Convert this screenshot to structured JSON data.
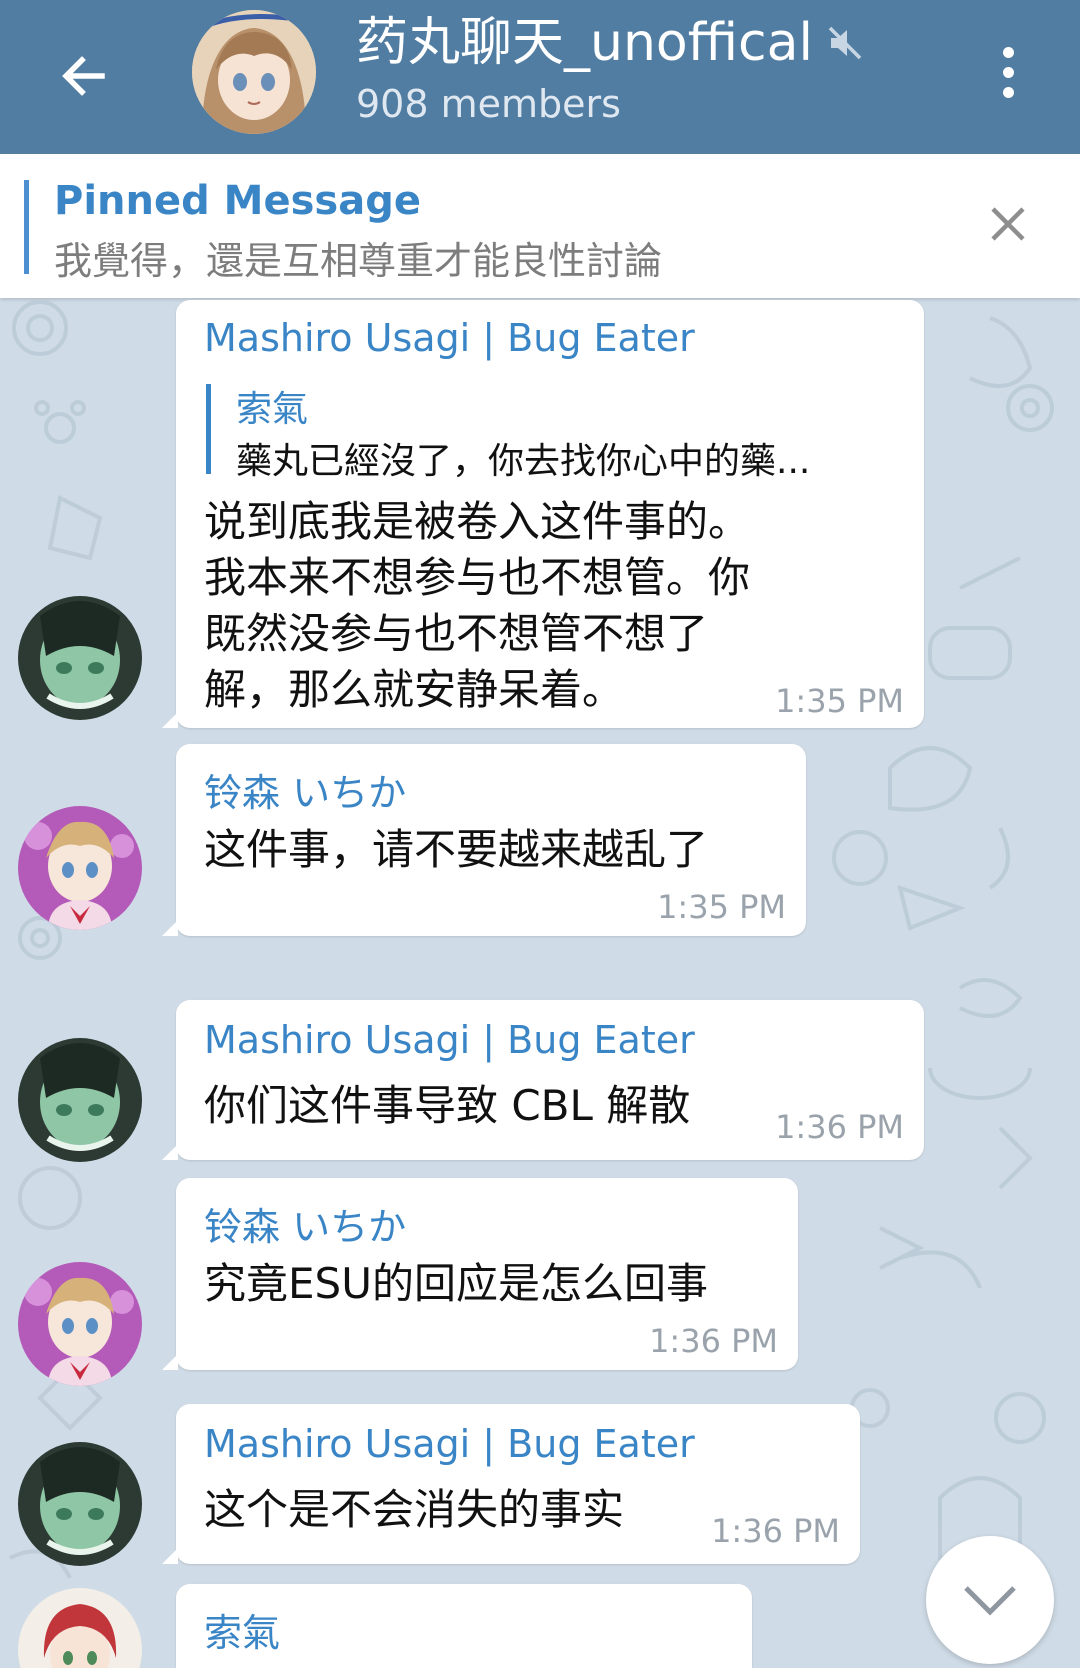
{
  "header": {
    "title": "药丸聊天_unoffical",
    "subtitle": "908 members",
    "back_icon": "arrow-left-icon",
    "muted_icon": "speaker-muted-icon",
    "menu_icon": "more-vertical-icon"
  },
  "pinned": {
    "title": "Pinned Message",
    "text": "我覺得，還是互相尊重才能良性討論",
    "close_icon": "close-icon"
  },
  "messages": [
    {
      "sender": "Mashiro Usagi | Bug Eater",
      "reply": {
        "name": "索氣",
        "text": "藥丸已經沒了，你去找你心中的藥..."
      },
      "lines": [
        "说到底我是被卷入这件事的。",
        "我本来不想参与也不想管。你",
        "既然没参与也不想管不想了",
        "解，那么就安静呆着。"
      ],
      "time": "1:35 PM"
    },
    {
      "sender": "铃森 いちか",
      "lines": [
        "这件事，请不要越来越乱了"
      ],
      "time": "1:35 PM"
    },
    {
      "sender": "Mashiro Usagi | Bug Eater",
      "lines": [
        "你们这件事导致 CBL 解散"
      ],
      "time": "1:36 PM"
    },
    {
      "sender": "铃森 いちか",
      "lines": [
        "究竟ESU的回应是怎么回事"
      ],
      "time": "1:36 PM"
    },
    {
      "sender": "Mashiro Usagi | Bug Eater",
      "lines": [
        "这个是不会消失的事实"
      ],
      "time": "1:36 PM"
    },
    {
      "sender": "索氣"
    }
  ],
  "scroll_down_icon": "chevron-down-icon",
  "colors": {
    "header_bg": "#517da2",
    "accent": "#3a85c6",
    "chat_bg": "#cfdbe6"
  }
}
